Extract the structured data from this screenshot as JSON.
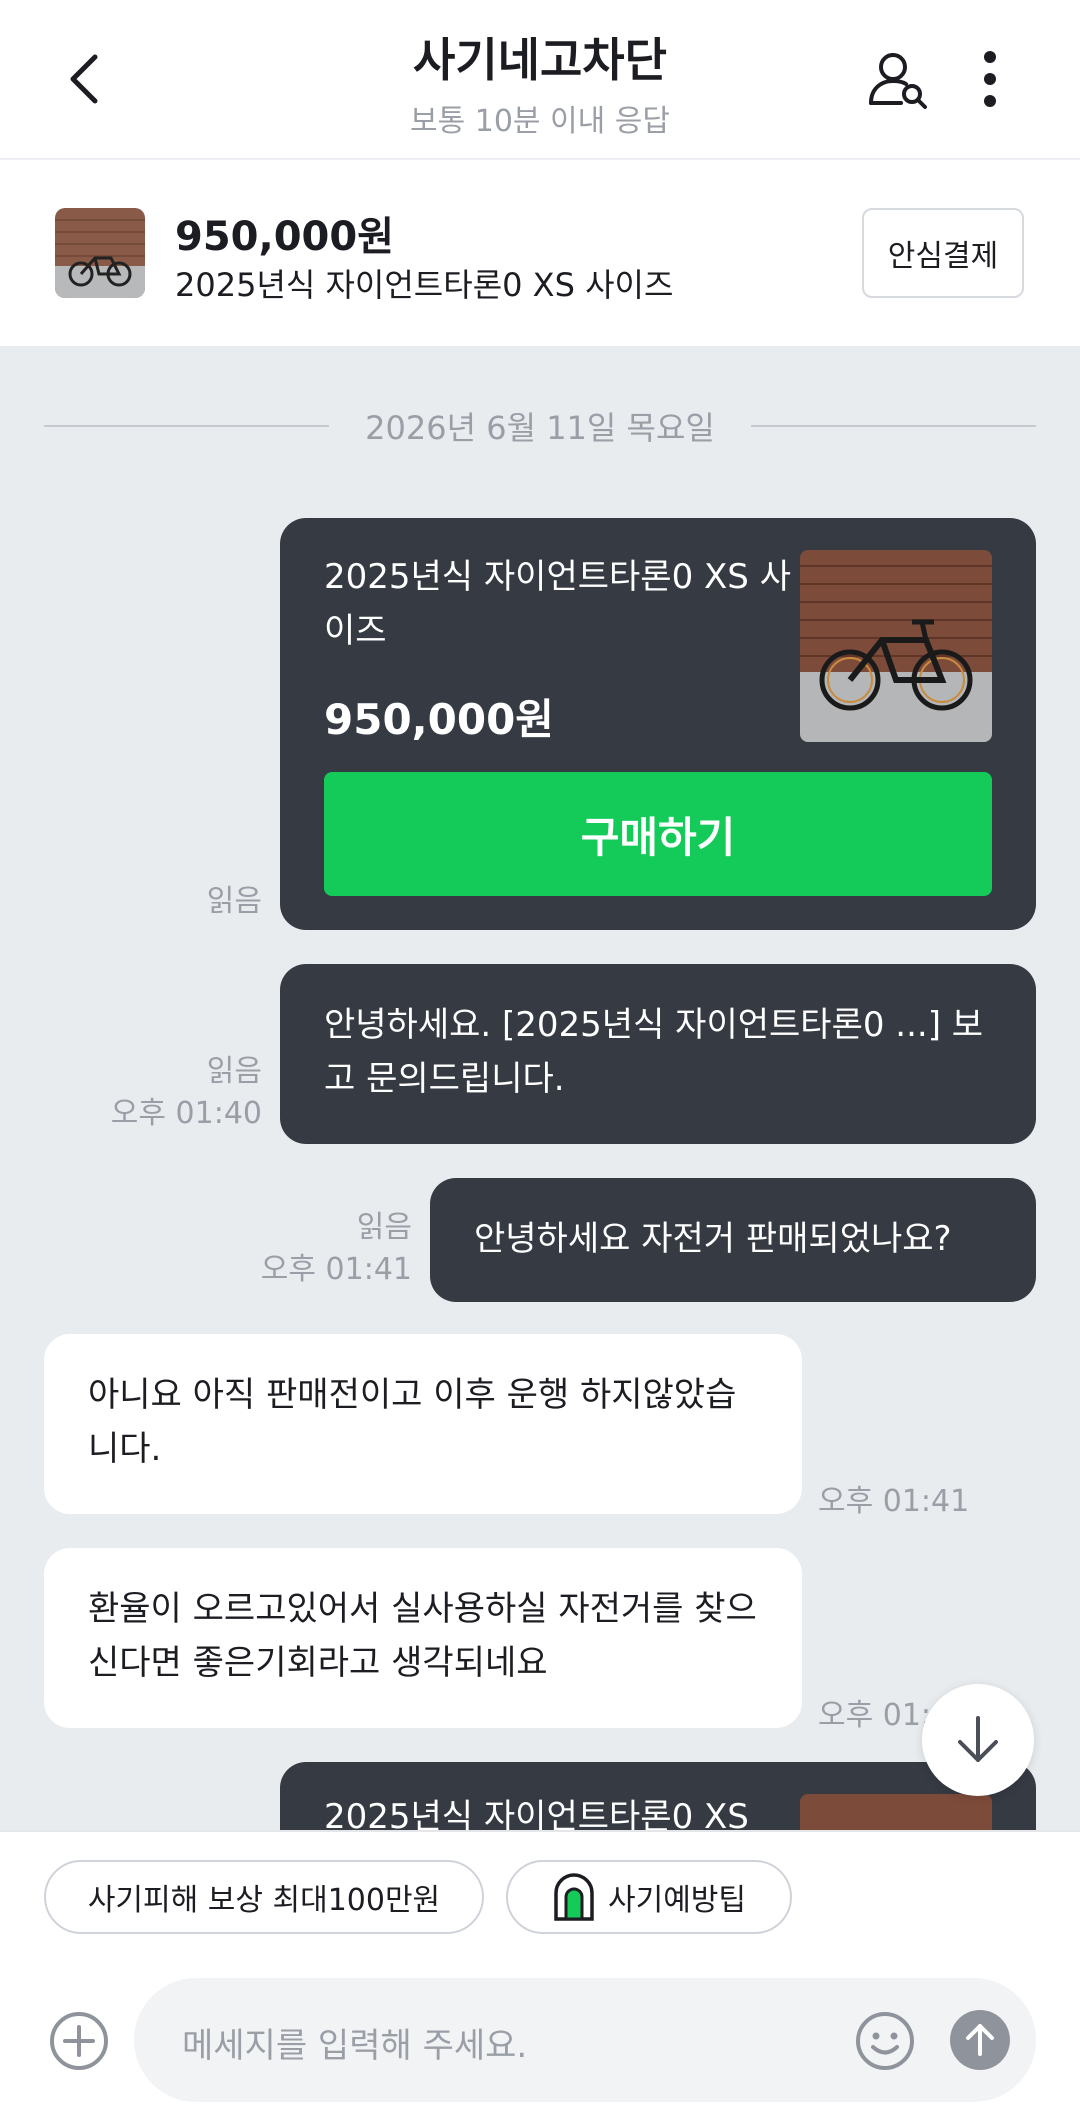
{
  "header": {
    "title": "사기네고차단",
    "subtitle": "보통 10분 이내 응답",
    "back_icon": "chevron-left-icon",
    "profile_icon": "user-search-icon",
    "more_icon": "more-vertical-icon"
  },
  "product": {
    "price": "950,000원",
    "name": "2025년식 자이언트타론0 XS 사이즈",
    "safe_pay_label": "안심결제"
  },
  "chat": {
    "date": "2026년 6월 11일 목요일",
    "card": {
      "title": "2025년식 자이언트타론0 XS 사이즈",
      "price": "950,000원",
      "buy_label": "구매하기",
      "read": "읽음"
    },
    "messages": [
      {
        "side": "me",
        "text": "안녕하세요. [2025년식 자이언트타론0 ...] 보고 문의드립니다.",
        "read": "읽음",
        "time": "오후 01:40"
      },
      {
        "side": "me",
        "text": "안녕하세요 자전거 판매되었나요?",
        "read": "읽음",
        "time": "오후 01:41"
      },
      {
        "side": "other",
        "text": "아니요 아직 판매전이고 이후 운행 하지않았습니다.",
        "time": "오후 01:41"
      },
      {
        "side": "other",
        "text": "환율이 오르고있어서 실사용하실 자전거를 찾으신다면 좋은기회라고 생각되네요",
        "time": "오후 01:42"
      }
    ],
    "card2_title_partial": "2025년식 자이언트타론0 XS"
  },
  "chips": [
    {
      "label": "사기피해 보상 최대100만원"
    },
    {
      "label": "사기예방팁",
      "icon": "shield-lock-icon"
    }
  ],
  "input": {
    "placeholder": "메세지를 입력해 주세요."
  },
  "colors": {
    "accent_green": "#14cb5a",
    "bubble_dark": "#353a43",
    "chat_bg": "#e9ecef"
  }
}
